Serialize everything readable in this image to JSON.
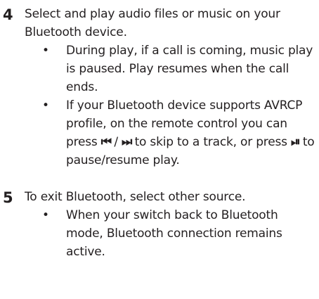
{
  "steps": [
    {
      "number": "4",
      "text": "Select and play audio files or music on your Bluetooth device.",
      "bullets": [
        {
          "text": "During play, if a call is coming, music play is paused. Play resumes when the call ends."
        },
        {
          "text_before": "If your Bluetooth device supports AVRCP profile, on the remote control you can press ",
          "prev_icon": "⏮",
          "separator": " / ",
          "next_icon": "⏭",
          "text_middle": " to skip to a track, or press ",
          "play_pause_icon": "⏯",
          "text_after": " to pause/resume play."
        }
      ]
    },
    {
      "number": "5",
      "text": "To exit Bluetooth, select other source.",
      "bullets": [
        {
          "text": "When your switch back to Bluetooth mode, Bluetooth connection remains active."
        }
      ]
    }
  ],
  "bullet_char": "•",
  "icons": {
    "prev": "previous-track-icon",
    "next": "next-track-icon",
    "play_pause": "play-pause-icon"
  }
}
